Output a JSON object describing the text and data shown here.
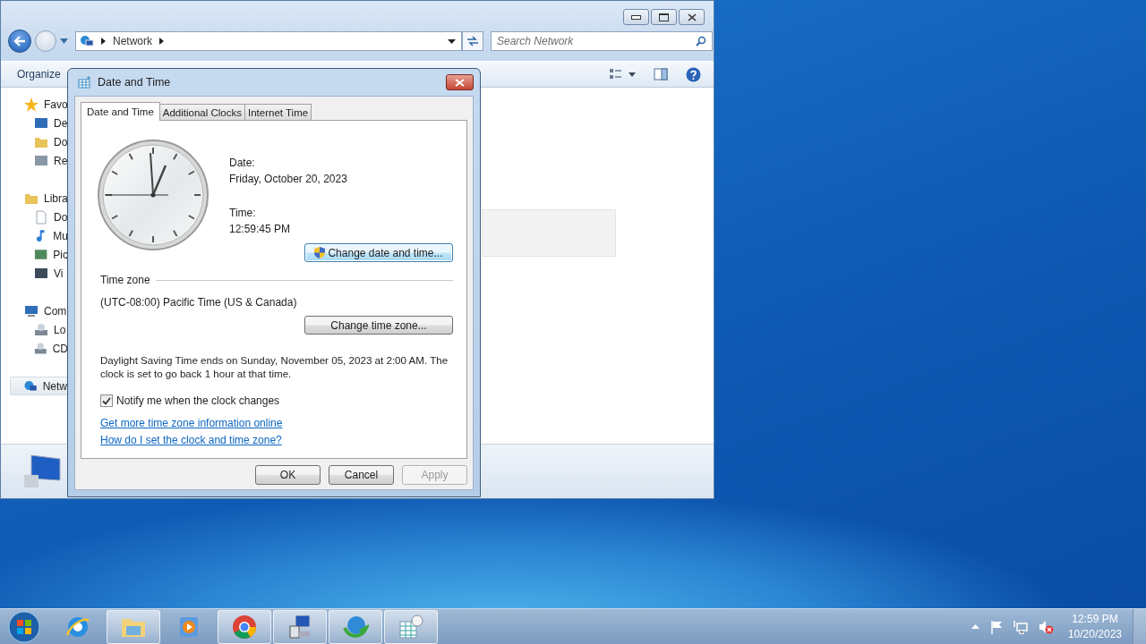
{
  "explorer": {
    "address": {
      "crumbs": [
        "Network"
      ]
    },
    "search": {
      "placeholder": "Search Network"
    },
    "toolbar": {
      "organize": "Organize"
    },
    "sidebar": [
      {
        "label": "Favo",
        "selected": false,
        "children": [
          {
            "label": "De",
            "selected": false
          },
          {
            "label": "Do",
            "selected": false
          },
          {
            "label": "Re",
            "selected": false
          }
        ]
      },
      {
        "label": "Libra",
        "selected": false,
        "children": [
          {
            "label": "Do",
            "selected": false
          },
          {
            "label": "Mu",
            "selected": false
          },
          {
            "label": "Pic",
            "selected": false
          },
          {
            "label": "Vi",
            "selected": false
          }
        ]
      },
      {
        "label": "Com",
        "selected": false,
        "children": [
          {
            "label": "Lo",
            "selected": false
          },
          {
            "label": "CD",
            "selected": false
          }
        ]
      },
      {
        "label": "Netw",
        "selected": true
      }
    ]
  },
  "dialog": {
    "title": "Date and Time",
    "tabs": [
      {
        "label": "Date and Time",
        "selected": true
      },
      {
        "label": "Additional Clocks",
        "selected": false
      },
      {
        "label": "Internet Time",
        "selected": false
      }
    ],
    "date_label": "Date:",
    "date": "Friday, October 20, 2023",
    "time_label": "Time:",
    "time": "12:59:45 PM",
    "change_datetime_button": {
      "label": "Change date and time...",
      "focused": true
    },
    "timezone_heading": "Time zone",
    "timezone": "(UTC-08:00) Pacific Time (US & Canada)",
    "change_timezone_button": {
      "label": "Change time zone...",
      "focused": false
    },
    "dst_note": "Daylight Saving Time ends on Sunday, November 05, 2023 at 2:00 AM. The clock is set to go back 1 hour at that time.",
    "notify": {
      "label": "Notify me when the clock changes",
      "checked": true
    },
    "links": [
      "Get more time zone information online",
      "How do I set the clock and time zone?"
    ],
    "buttons": [
      {
        "label": "OK",
        "disabled": false
      },
      {
        "label": "Cancel",
        "disabled": false
      },
      {
        "label": "Apply",
        "disabled": true
      }
    ]
  },
  "taskbar": {
    "apps": [
      {
        "running": false
      },
      {
        "running": true
      },
      {
        "running": false
      },
      {
        "running": true
      },
      {
        "running": true
      },
      {
        "running": true
      },
      {
        "running": true
      }
    ],
    "clock": {
      "time": "12:59 PM",
      "date": "10/20/2023"
    }
  }
}
